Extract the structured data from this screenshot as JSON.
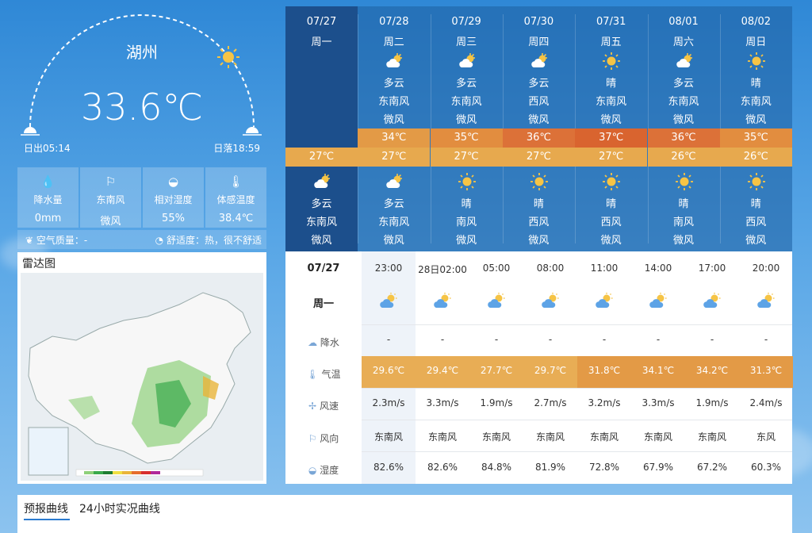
{
  "current": {
    "city": "湖州",
    "temperature": "33.6℃",
    "sunrise": "日出05:14",
    "sunset": "日落18:59",
    "stats": [
      {
        "icon": "rain-drops-icon",
        "label": "降水量",
        "value": "0mm"
      },
      {
        "icon": "wind-vane-icon",
        "label": "东南风",
        "value": "微风"
      },
      {
        "icon": "humidity-drop-icon",
        "label": "相对湿度",
        "value": "55%"
      },
      {
        "icon": "thermometer-icon",
        "label": "体感温度",
        "value": "38.4℃"
      }
    ],
    "air_quality": "空气质量：-",
    "comfort": "舒适度：热，很不舒适"
  },
  "radar": {
    "title": "雷达图"
  },
  "forecast": [
    {
      "date": "07/27",
      "weekday": "周一",
      "day_wx": "",
      "day_wind": "",
      "day_force": "",
      "high": "",
      "low": "27℃",
      "night_wx": "多云",
      "night_wind": "东南风",
      "night_force": "微风",
      "day_icon": "none",
      "night_icon": "cloudy-sun"
    },
    {
      "date": "07/28",
      "weekday": "周二",
      "day_wx": "多云",
      "day_wind": "东南风",
      "day_force": "微风",
      "high": "34℃",
      "low": "27℃",
      "night_wx": "多云",
      "night_wind": "东南风",
      "night_force": "微风",
      "day_icon": "cloudy-sun",
      "night_icon": "cloudy-sun",
      "high_color": "#e39a46"
    },
    {
      "date": "07/29",
      "weekday": "周三",
      "day_wx": "多云",
      "day_wind": "东南风",
      "day_force": "微风",
      "high": "35℃",
      "low": "27℃",
      "night_wx": "晴",
      "night_wind": "南风",
      "night_force": "微风",
      "day_icon": "cloudy-sun",
      "night_icon": "sun",
      "high_color": "#e28d3f"
    },
    {
      "date": "07/30",
      "weekday": "周四",
      "day_wx": "多云",
      "day_wind": "西风",
      "day_force": "微风",
      "high": "36℃",
      "low": "27℃",
      "night_wx": "晴",
      "night_wind": "西风",
      "night_force": "微风",
      "day_icon": "cloudy-sun",
      "night_icon": "sun",
      "high_color": "#dc7138"
    },
    {
      "date": "07/31",
      "weekday": "周五",
      "day_wx": "晴",
      "day_wind": "东南风",
      "day_force": "微风",
      "high": "37℃",
      "low": "27℃",
      "night_wx": "晴",
      "night_wind": "西风",
      "night_force": "微风",
      "day_icon": "sun",
      "night_icon": "sun",
      "high_color": "#d9642f"
    },
    {
      "date": "08/01",
      "weekday": "周六",
      "day_wx": "多云",
      "day_wind": "东南风",
      "day_force": "微风",
      "high": "36℃",
      "low": "26℃",
      "night_wx": "晴",
      "night_wind": "南风",
      "night_force": "微风",
      "day_icon": "cloudy-sun",
      "night_icon": "sun",
      "high_color": "#dc7138"
    },
    {
      "date": "08/02",
      "weekday": "周日",
      "day_wx": "晴",
      "day_wind": "东南风",
      "day_force": "微风",
      "high": "35℃",
      "low": "26℃",
      "night_wx": "晴",
      "night_wind": "西风",
      "night_force": "微风",
      "day_icon": "sun",
      "night_icon": "sun",
      "high_color": "#e28d3f"
    }
  ],
  "hourly": {
    "date": "07/27",
    "weekday": "周一",
    "labels": {
      "precip": "降水",
      "temp": "气温",
      "wind_speed": "风速",
      "wind_dir": "风向",
      "humidity": "湿度"
    },
    "times": [
      "23:00",
      "28日02:00",
      "05:00",
      "08:00",
      "11:00",
      "14:00",
      "17:00",
      "20:00"
    ],
    "precip": [
      "-",
      "-",
      "-",
      "-",
      "-",
      "-",
      "-",
      "-"
    ],
    "temps": [
      "29.6℃",
      "29.4℃",
      "27.7℃",
      "29.7℃",
      "31.8℃",
      "34.1℃",
      "34.2℃",
      "31.3℃"
    ],
    "temp_colors": [
      "#e8ad55",
      "#e8ad55",
      "#e8ad55",
      "#e8ad55",
      "#e39a46",
      "#e39a46",
      "#e39a46",
      "#e39a46"
    ],
    "wind_speed": [
      "2.3m/s",
      "3.3m/s",
      "1.9m/s",
      "2.7m/s",
      "3.2m/s",
      "3.3m/s",
      "1.9m/s",
      "2.4m/s"
    ],
    "wind_dir": [
      "东南风",
      "东南风",
      "东南风",
      "东南风",
      "东南风",
      "东南风",
      "东南风",
      "东风"
    ],
    "humidity": [
      "82.6%",
      "82.6%",
      "84.8%",
      "81.9%",
      "72.8%",
      "67.9%",
      "67.2%",
      "60.3%"
    ]
  },
  "tabs": [
    "预报曲线",
    "24小时实况曲线"
  ]
}
